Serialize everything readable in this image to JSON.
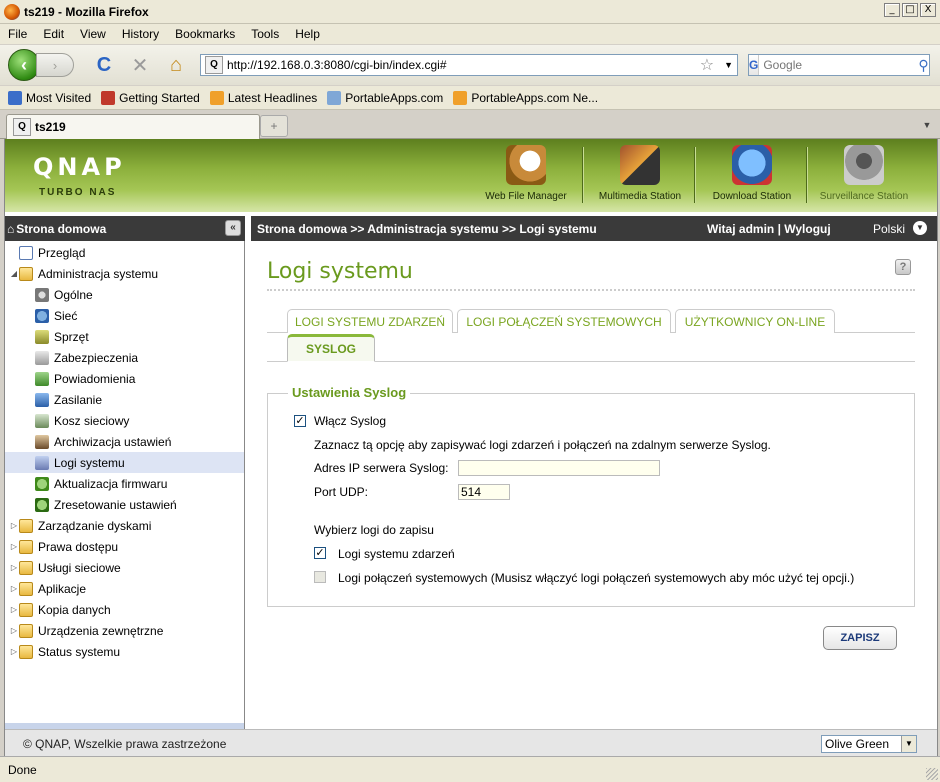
{
  "window": {
    "title": "ts219 - Mozilla Firefox",
    "minimize": "_",
    "maximize": "□",
    "close": "X"
  },
  "menu": [
    "File",
    "Edit",
    "View",
    "History",
    "Bookmarks",
    "Tools",
    "Help"
  ],
  "nav": {
    "back": "‹",
    "forward": "›",
    "reload": "C",
    "stop": "✕",
    "home": "⌂",
    "url": "http://192.168.0.3:8080/cgi-bin/index.cgi#",
    "search_placeholder": "Google",
    "search_engine": "G"
  },
  "bookmarks": [
    {
      "label": "Most Visited",
      "icon": "most-visited-icon"
    },
    {
      "label": "Getting Started",
      "icon": "firefox-icon"
    },
    {
      "label": "Latest Headlines",
      "icon": "rss-icon"
    },
    {
      "label": "PortableApps.com",
      "icon": "portableapps-icon"
    },
    {
      "label": "PortableApps.com Ne...",
      "icon": "rss-icon"
    }
  ],
  "browser_tab": {
    "label": "ts219",
    "new_tab": "+"
  },
  "qnap": {
    "logo": "QNAP",
    "sublogo": "TURBO NAS",
    "stations": [
      {
        "label": "Web File Manager",
        "icon": "web-file-manager-icon",
        "enabled": true
      },
      {
        "label": "Multimedia Station",
        "icon": "multimedia-station-icon",
        "enabled": true
      },
      {
        "label": "Download Station",
        "icon": "download-station-icon",
        "enabled": true
      },
      {
        "label": "Surveillance Station",
        "icon": "surveillance-station-icon",
        "enabled": false
      }
    ]
  },
  "left_header": {
    "title": "Strona domowa",
    "collapse": "«"
  },
  "right_header": {
    "breadcrumb": "Strona domowa >> Administracja systemu >> Logi systemu",
    "welcome": "Witaj admin | Wyloguj",
    "language": "Polski"
  },
  "tree": [
    {
      "label": "Przegląd",
      "level": 0,
      "expand": "",
      "icon": "overview-icon"
    },
    {
      "label": "Administracja systemu",
      "level": 0,
      "expand": "◢",
      "icon": "folder-icon"
    },
    {
      "label": "Ogólne",
      "level": 1,
      "icon": "general-settings-icon"
    },
    {
      "label": "Sieć",
      "level": 1,
      "icon": "network-icon"
    },
    {
      "label": "Sprzęt",
      "level": 1,
      "icon": "hardware-icon"
    },
    {
      "label": "Zabezpieczenia",
      "level": 1,
      "icon": "security-icon"
    },
    {
      "label": "Powiadomienia",
      "level": 1,
      "icon": "notification-icon"
    },
    {
      "label": "Zasilanie",
      "level": 1,
      "icon": "power-icon"
    },
    {
      "label": "Kosz sieciowy",
      "level": 1,
      "icon": "recycle-bin-icon"
    },
    {
      "label": "Archiwizacja ustawień",
      "level": 1,
      "icon": "backup-settings-icon"
    },
    {
      "label": "Logi systemu",
      "level": 1,
      "icon": "system-logs-icon",
      "selected": true
    },
    {
      "label": "Aktualizacja firmwaru",
      "level": 1,
      "icon": "firmware-update-icon"
    },
    {
      "label": "Zresetowanie ustawień",
      "level": 1,
      "icon": "reset-settings-icon"
    },
    {
      "label": "Zarządzanie dyskami",
      "level": 0,
      "expand": "▷",
      "icon": "folder-icon"
    },
    {
      "label": "Prawa dostępu",
      "level": 0,
      "expand": "▷",
      "icon": "folder-icon"
    },
    {
      "label": "Usługi sieciowe",
      "level": 0,
      "expand": "▷",
      "icon": "folder-icon"
    },
    {
      "label": "Aplikacje",
      "level": 0,
      "expand": "▷",
      "icon": "folder-icon"
    },
    {
      "label": "Kopia danych",
      "level": 0,
      "expand": "▷",
      "icon": "folder-icon"
    },
    {
      "label": "Urządzenia zewnętrzne",
      "level": 0,
      "expand": "▷",
      "icon": "folder-icon"
    },
    {
      "label": "Status systemu",
      "level": 0,
      "expand": "▷",
      "icon": "folder-icon"
    }
  ],
  "page": {
    "title": "Logi systemu",
    "help": "?",
    "tabs_row1": [
      "LOGI SYSTEMU ZDARZEŃ",
      "LOGI POŁĄCZEŃ SYSTEMOWYCH",
      "UŻYTKOWNICY ON-LINE"
    ],
    "tab_active": "SYSLOG",
    "section_title": "Ustawienia Syslog",
    "enable_syslog": {
      "label": "Włącz Syslog",
      "checked": true
    },
    "description": "Zaznacz tą opcję aby zapisywać logi zdarzeń i połączeń na zdalnym serwerze Syslog.",
    "ip_label": "Adres IP serwera Syslog:",
    "ip_value": "",
    "port_label": "Port UDP:",
    "port_value": "514",
    "choose_label": "Wybierz logi do zapisu",
    "event_logs": {
      "label": "Logi systemu zdarzeń",
      "checked": true
    },
    "conn_logs": {
      "label": "Logi połączeń systemowych (Musisz włączyć logi połączeń systemowych aby móc użyć tej opcji.)",
      "checked": false,
      "disabled": true
    },
    "save_label": "ZAPISZ"
  },
  "footer": {
    "copyright": "© QNAP, Wszelkie prawa zastrzeżone",
    "theme": "Olive Green"
  },
  "status": {
    "text": "Done"
  }
}
